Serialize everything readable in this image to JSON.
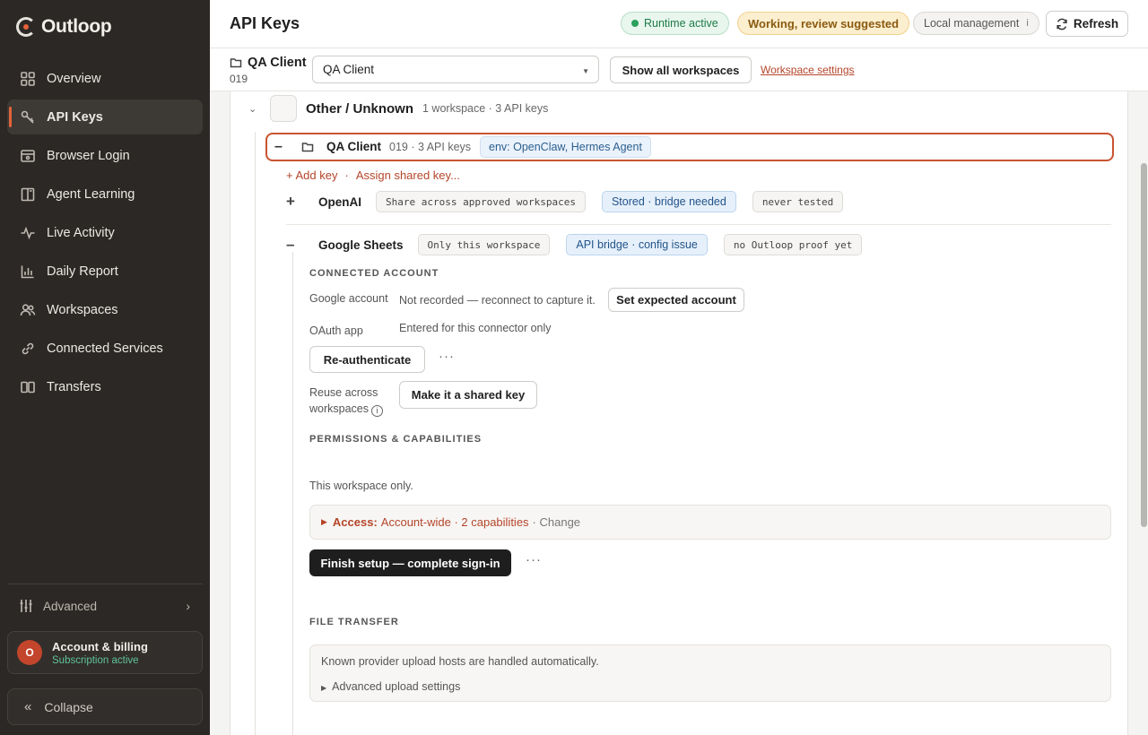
{
  "app": {
    "name": "Outloop"
  },
  "sidebar": {
    "items": [
      {
        "label": "Overview",
        "icon": "grid-icon"
      },
      {
        "label": "API Keys",
        "icon": "key-icon",
        "active": true
      },
      {
        "label": "Browser Login",
        "icon": "browser-icon"
      },
      {
        "label": "Agent Learning",
        "icon": "book-icon"
      },
      {
        "label": "Live Activity",
        "icon": "pulse-icon"
      },
      {
        "label": "Daily Report",
        "icon": "bar-chart-icon"
      },
      {
        "label": "Workspaces",
        "icon": "users-icon"
      },
      {
        "label": "Connected Services",
        "icon": "link-icon"
      },
      {
        "label": "Transfers",
        "icon": "columns-icon"
      }
    ],
    "advanced_label": "Advanced",
    "account": {
      "initial": "O",
      "title": "Account & billing",
      "subtitle": "Subscription active"
    },
    "collapse_label": "Collapse"
  },
  "header": {
    "title": "API Keys",
    "status_runtime": "Runtime active",
    "status_working": "Working, review suggested",
    "status_local": "Local management",
    "local_info": "i",
    "refresh_label": "Refresh"
  },
  "workspace_bar": {
    "name": "QA Client",
    "number": "019",
    "select_value": "QA Client",
    "show_all_label": "Show all workspaces",
    "settings_link": "Workspace settings"
  },
  "group": {
    "title": "Other / Unknown",
    "meta": "1 workspace · 3 API keys"
  },
  "workspace": {
    "title": "QA Client",
    "meta": "019 · 3 API keys",
    "env_tag": "env: OpenClaw, Hermes Agent",
    "add_key": "+ Add key",
    "assign_key": "Assign shared key..."
  },
  "services": [
    {
      "sign": "+",
      "name": "OpenAI",
      "scope": "Share across approved workspaces",
      "status": "Stored · bridge needed",
      "test": "never tested"
    },
    {
      "sign": "–",
      "name": "Google Sheets",
      "scope": "Only this workspace",
      "status": "API bridge · config issue",
      "test": "no Outloop proof yet"
    }
  ],
  "connected_account": {
    "heading": "CONNECTED ACCOUNT",
    "google_label": "Google account",
    "google_value": "Not recorded — reconnect to capture it.",
    "set_expected": "Set expected account",
    "oauth_label": "OAuth app",
    "oauth_value": "Entered for this connector only",
    "reauth": "Re-authenticate",
    "more": "···",
    "reuse_label_1": "Reuse across",
    "reuse_label_2": "workspaces",
    "reuse_info": "i",
    "make_shared": "Make it a shared key"
  },
  "permissions": {
    "heading": "PERMISSIONS & CAPABILITIES",
    "scope_text": "This workspace only.",
    "access_label": "Access:",
    "access_value": "Account-wide · 2 capabilities",
    "access_change": "· Change",
    "finish_setup": "Finish setup — complete sign-in",
    "more": "···"
  },
  "file_transfer": {
    "heading": "FILE TRANSFER",
    "text": "Known provider upload hosts are handled automatically.",
    "advanced": "Advanced upload settings"
  },
  "colors": {
    "accent": "#e3623a",
    "link": "#b5452a",
    "sidebar_bg": "#2b2825"
  }
}
